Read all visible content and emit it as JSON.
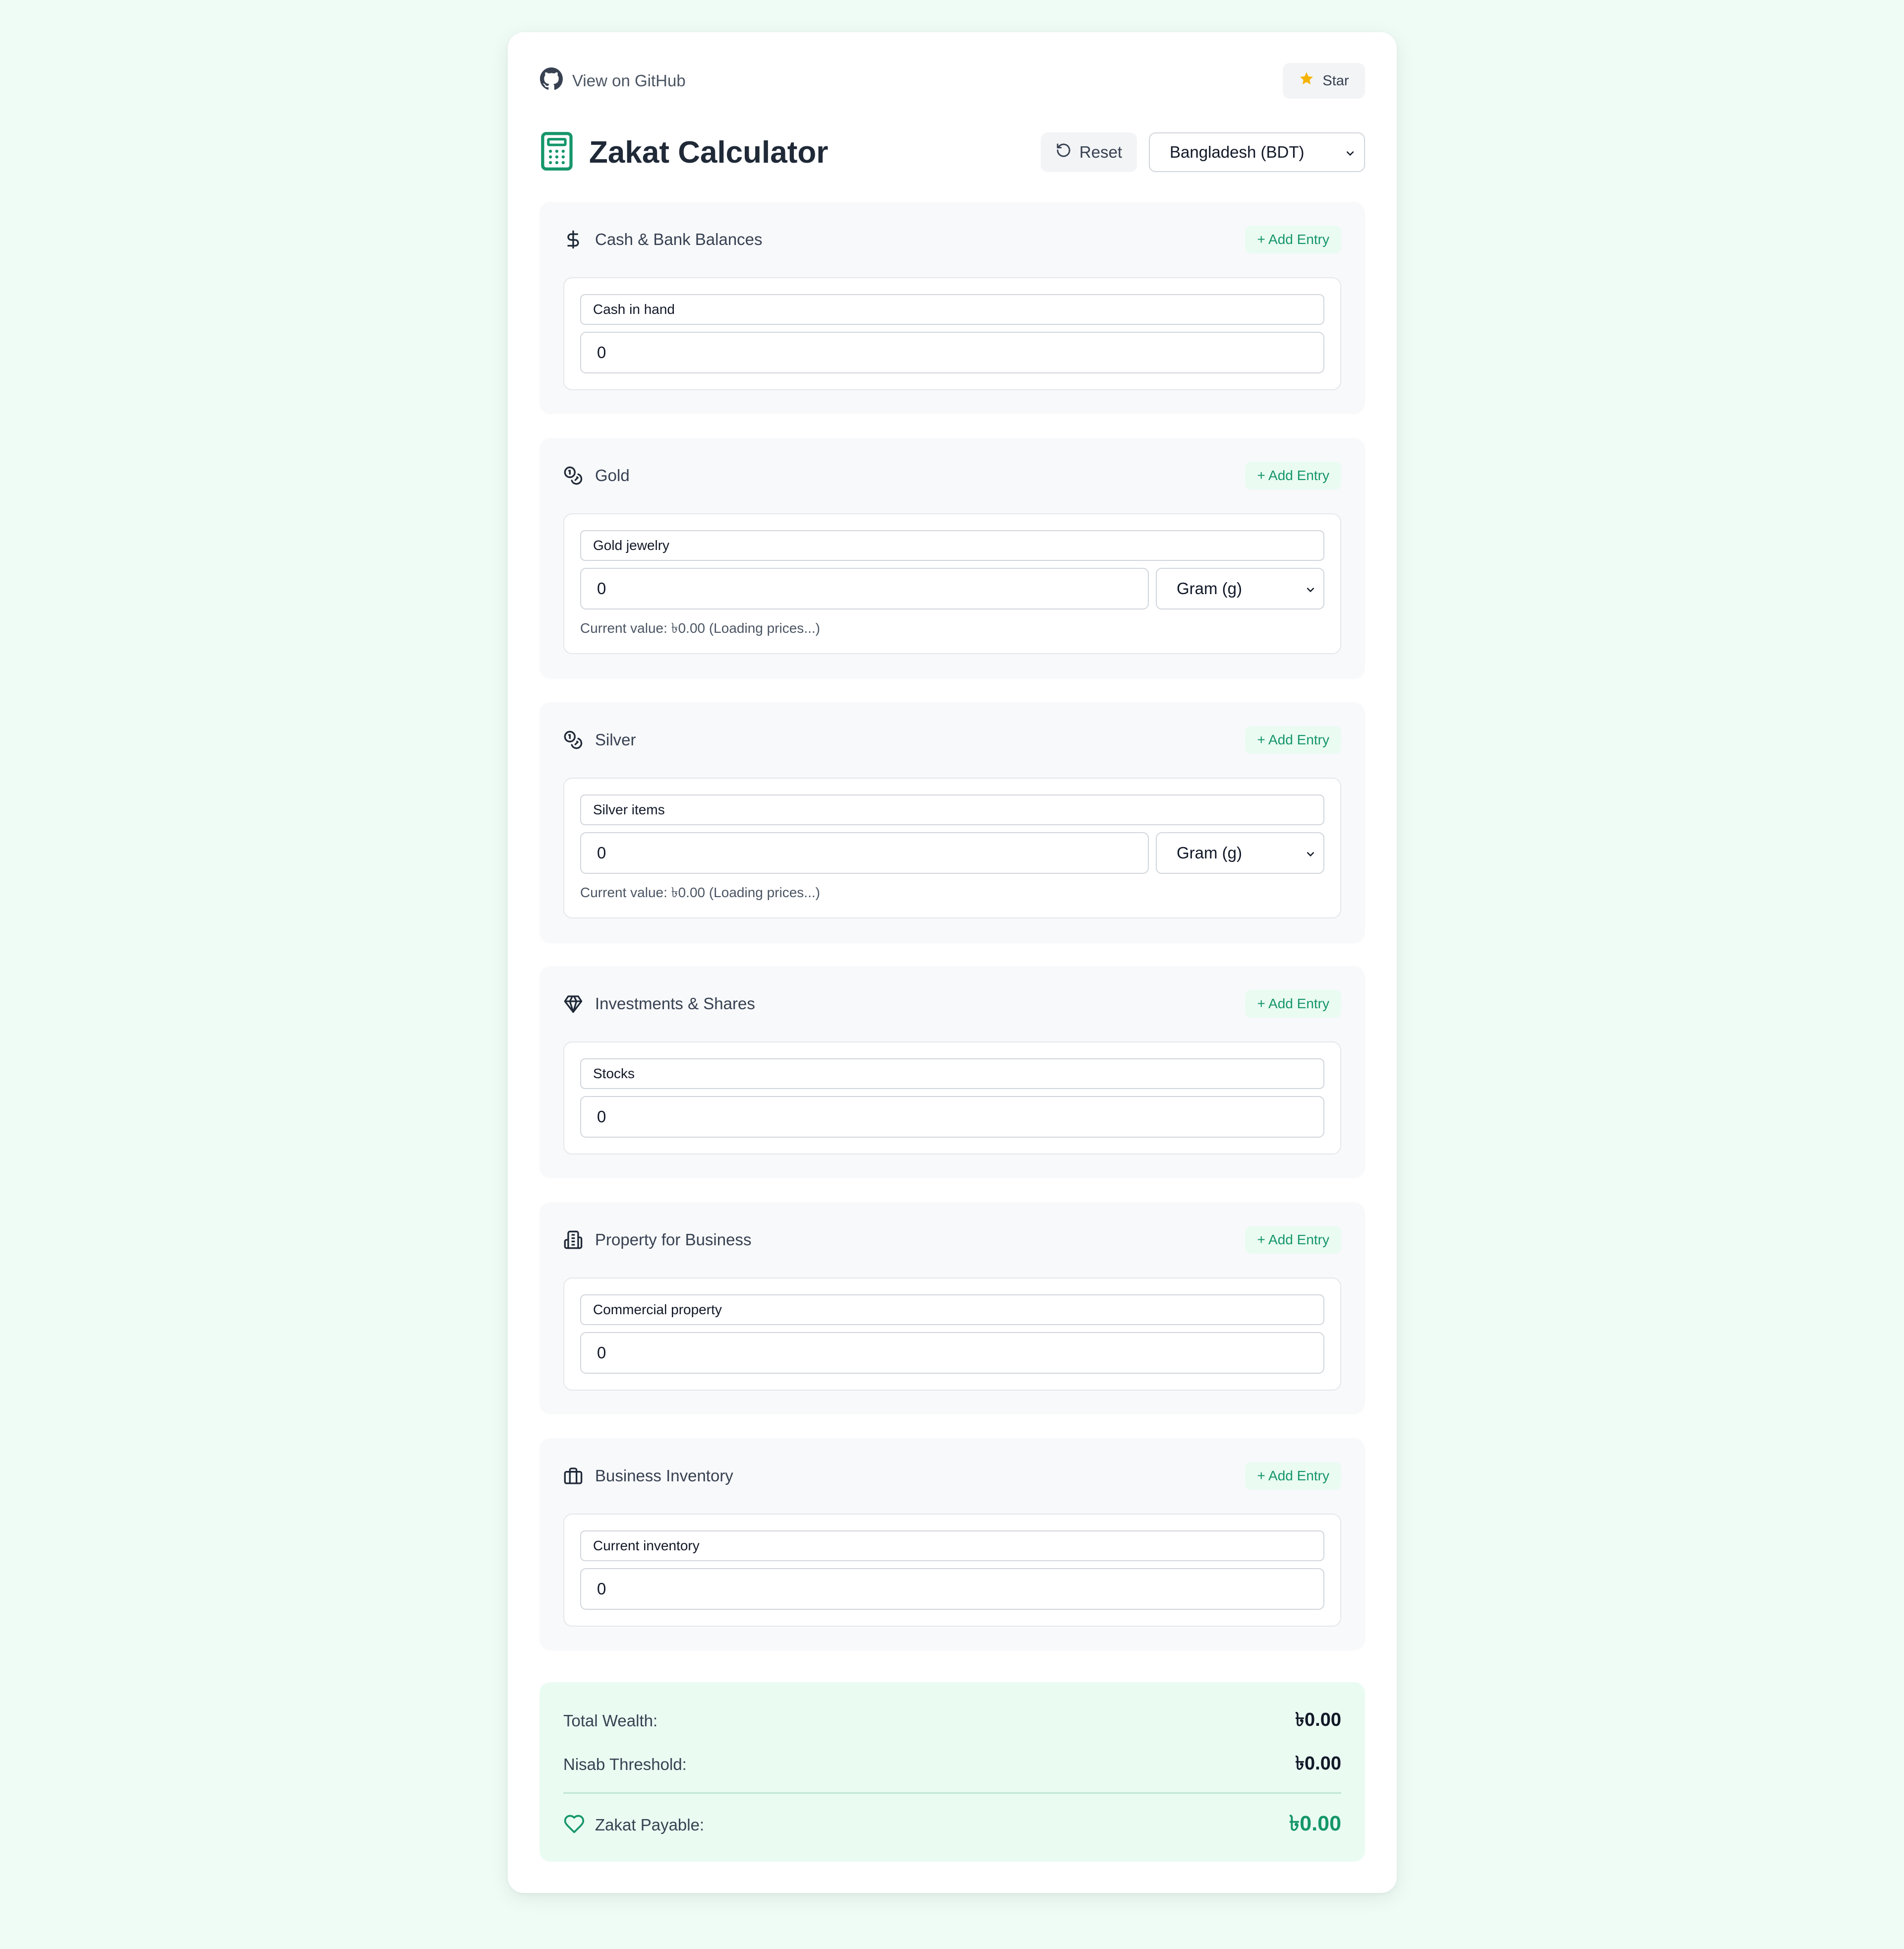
{
  "topbar": {
    "github_label": "View on GitHub",
    "star_label": "Star"
  },
  "header": {
    "title": "Zakat Calculator",
    "reset_label": "Reset",
    "country": "Bangladesh (BDT)"
  },
  "sections": {
    "cash": {
      "title": "Cash & Bank Balances",
      "add_label": "+ Add Entry",
      "entry_label": "Cash in hand",
      "amount": "0"
    },
    "gold": {
      "title": "Gold",
      "add_label": "+ Add Entry",
      "entry_label": "Gold jewelry",
      "amount": "0",
      "unit": "Gram (g)",
      "note": "Current value: ৳0.00 (Loading prices...)"
    },
    "silver": {
      "title": "Silver",
      "add_label": "+ Add Entry",
      "entry_label": "Silver items",
      "amount": "0",
      "unit": "Gram (g)",
      "note": "Current value: ৳0.00 (Loading prices...)"
    },
    "investments": {
      "title": "Investments & Shares",
      "add_label": "+ Add Entry",
      "entry_label": "Stocks",
      "amount": "0"
    },
    "property": {
      "title": "Property for Business",
      "add_label": "+ Add Entry",
      "entry_label": "Commercial property",
      "amount": "0"
    },
    "inventory": {
      "title": "Business Inventory",
      "add_label": "+ Add Entry",
      "entry_label": "Current inventory",
      "amount": "0"
    }
  },
  "summary": {
    "total_label": "Total Wealth:",
    "total_value": "৳0.00",
    "nisab_label": "Nisab Threshold:",
    "nisab_value": "৳0.00",
    "payable_label": "Zakat Payable:",
    "payable_value": "৳0.00"
  },
  "icons": {
    "github": "github-icon",
    "star": "star-icon",
    "logo": "calculator-icon",
    "reset": "rotate-ccw-icon",
    "cash": "dollar-sign-icon",
    "gold": "coins-icon",
    "silver": "coins-icon",
    "investments": "gem-icon",
    "property": "building-icon",
    "inventory": "briefcase-icon",
    "payable": "heart-icon"
  },
  "colors": {
    "accent": "#15966a",
    "page_bg": "#effcf6",
    "section_bg": "#f8f9fb",
    "summary_bg": "#eafbf2",
    "star": "#f5b301"
  }
}
